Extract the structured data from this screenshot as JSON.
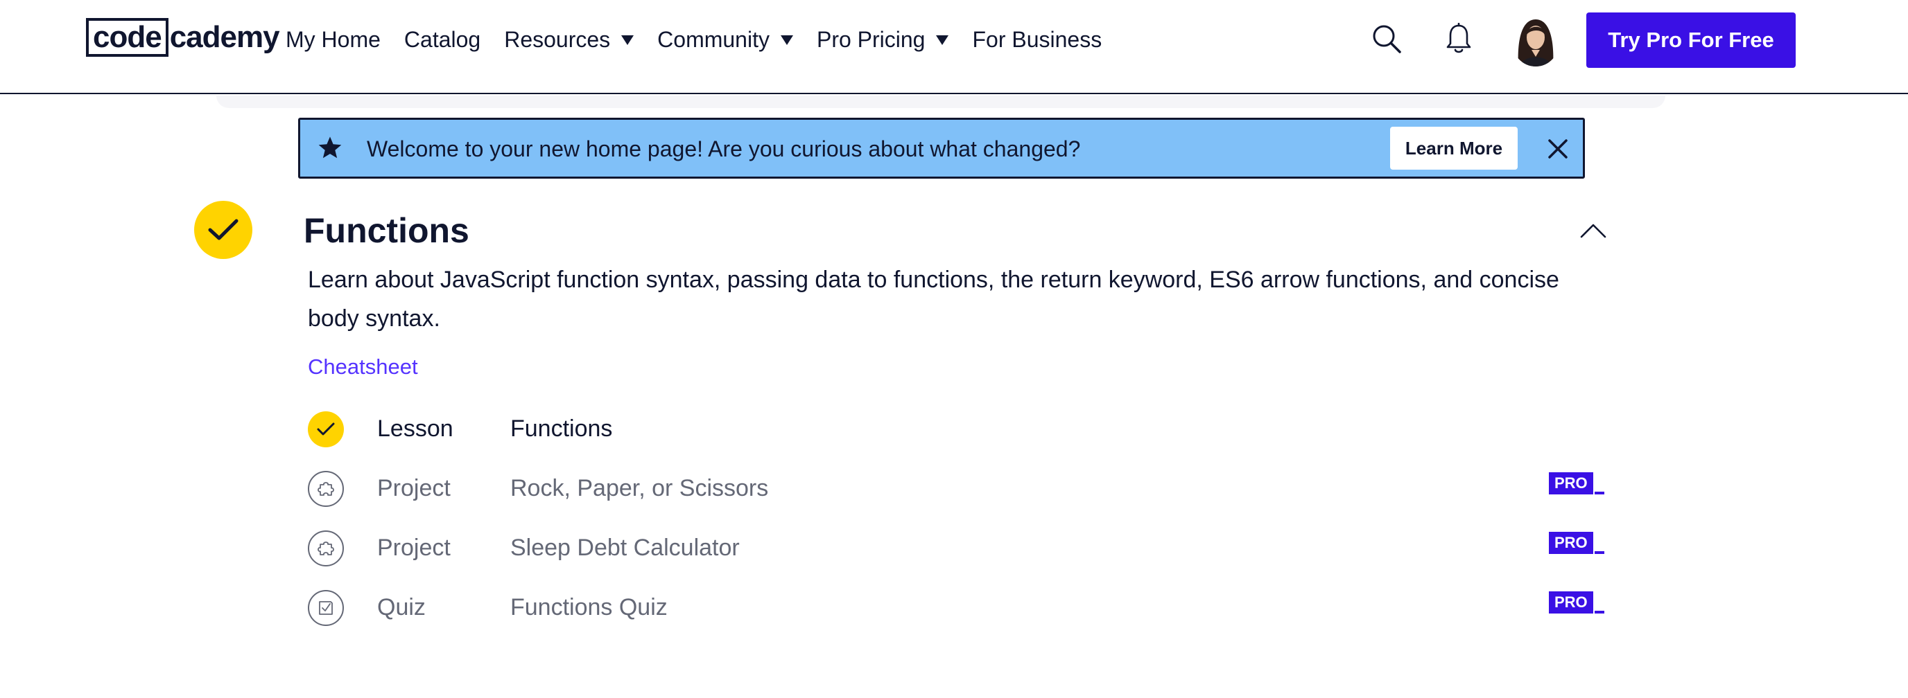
{
  "header": {
    "logo": {
      "boxed": "code",
      "rest": "cademy"
    },
    "nav": [
      {
        "label": "My Home",
        "dropdown": false
      },
      {
        "label": "Catalog",
        "dropdown": false
      },
      {
        "label": "Resources",
        "dropdown": true
      },
      {
        "label": "Community",
        "dropdown": true
      },
      {
        "label": "Pro Pricing",
        "dropdown": true
      },
      {
        "label": "For Business",
        "dropdown": false
      }
    ],
    "icons": {
      "search": "search-icon",
      "notifications": "bell-icon",
      "avatar": "user-avatar"
    },
    "cta_label": "Try Pro For Free"
  },
  "banner": {
    "icon": "star-icon",
    "text": "Welcome to your new home page! Are you curious about what changed?",
    "button_label": "Learn More",
    "close_icon": "close-icon"
  },
  "module": {
    "status_icon": "check-icon",
    "title": "Functions",
    "description": "Learn about JavaScript function syntax, passing data to functions, the return keyword, ES6 arrow functions, and concise body syntax.",
    "cheatsheet_label": "Cheatsheet",
    "collapse_icon": "chevron-up-icon",
    "items": [
      {
        "type": "Lesson",
        "name": "Functions",
        "icon": "check-icon",
        "completed": true,
        "pro": false
      },
      {
        "type": "Project",
        "name": "Rock, Paper, or Scissors",
        "icon": "puzzle-icon",
        "completed": false,
        "pro": true
      },
      {
        "type": "Project",
        "name": "Sleep Debt Calculator",
        "icon": "puzzle-icon",
        "completed": false,
        "pro": true
      },
      {
        "type": "Quiz",
        "name": "Functions Quiz",
        "icon": "quiz-icon",
        "completed": false,
        "pro": true
      }
    ],
    "pro_badge_label": "PRO"
  },
  "colors": {
    "brand_navy": "#10162f",
    "brand_purple": "#3a10e5",
    "link_purple": "#5533ff",
    "banner_blue": "#80c0f8",
    "complete_yellow": "#ffd300",
    "muted_gray": "#646876"
  }
}
